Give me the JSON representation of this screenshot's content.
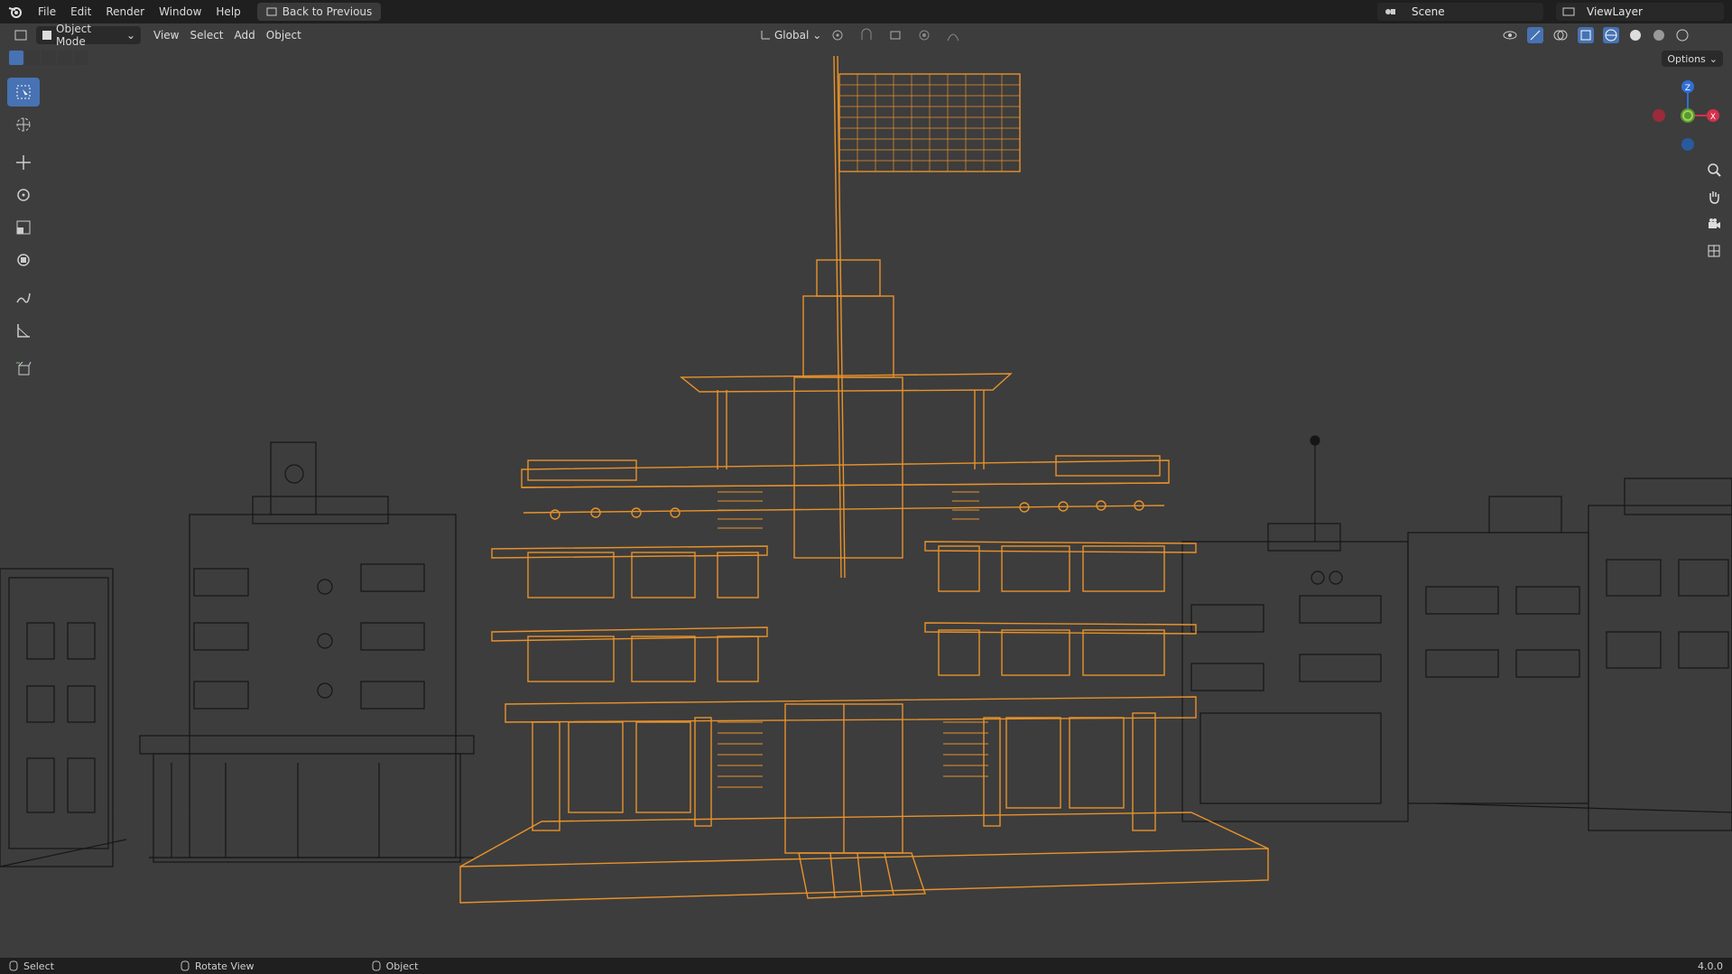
{
  "topbar": {
    "menu": [
      "File",
      "Edit",
      "Render",
      "Window",
      "Help"
    ],
    "back_button": "Back to Previous",
    "scene": "Scene",
    "view_layer": "ViewLayer"
  },
  "header": {
    "mode": "Object Mode",
    "menu": [
      "View",
      "Select",
      "Add",
      "Object"
    ],
    "transform_orientation": "Global",
    "options": "Options"
  },
  "gizmo": {
    "z": "Z",
    "x": "X"
  },
  "status": {
    "select": "Select",
    "rotate": "Rotate View",
    "object": "Object",
    "version": "4.0.0"
  },
  "colors": {
    "selected_wire": "#e8922a",
    "unselected_wire": "#111111",
    "accent": "#4772b3",
    "background": "#3d3d3d"
  }
}
